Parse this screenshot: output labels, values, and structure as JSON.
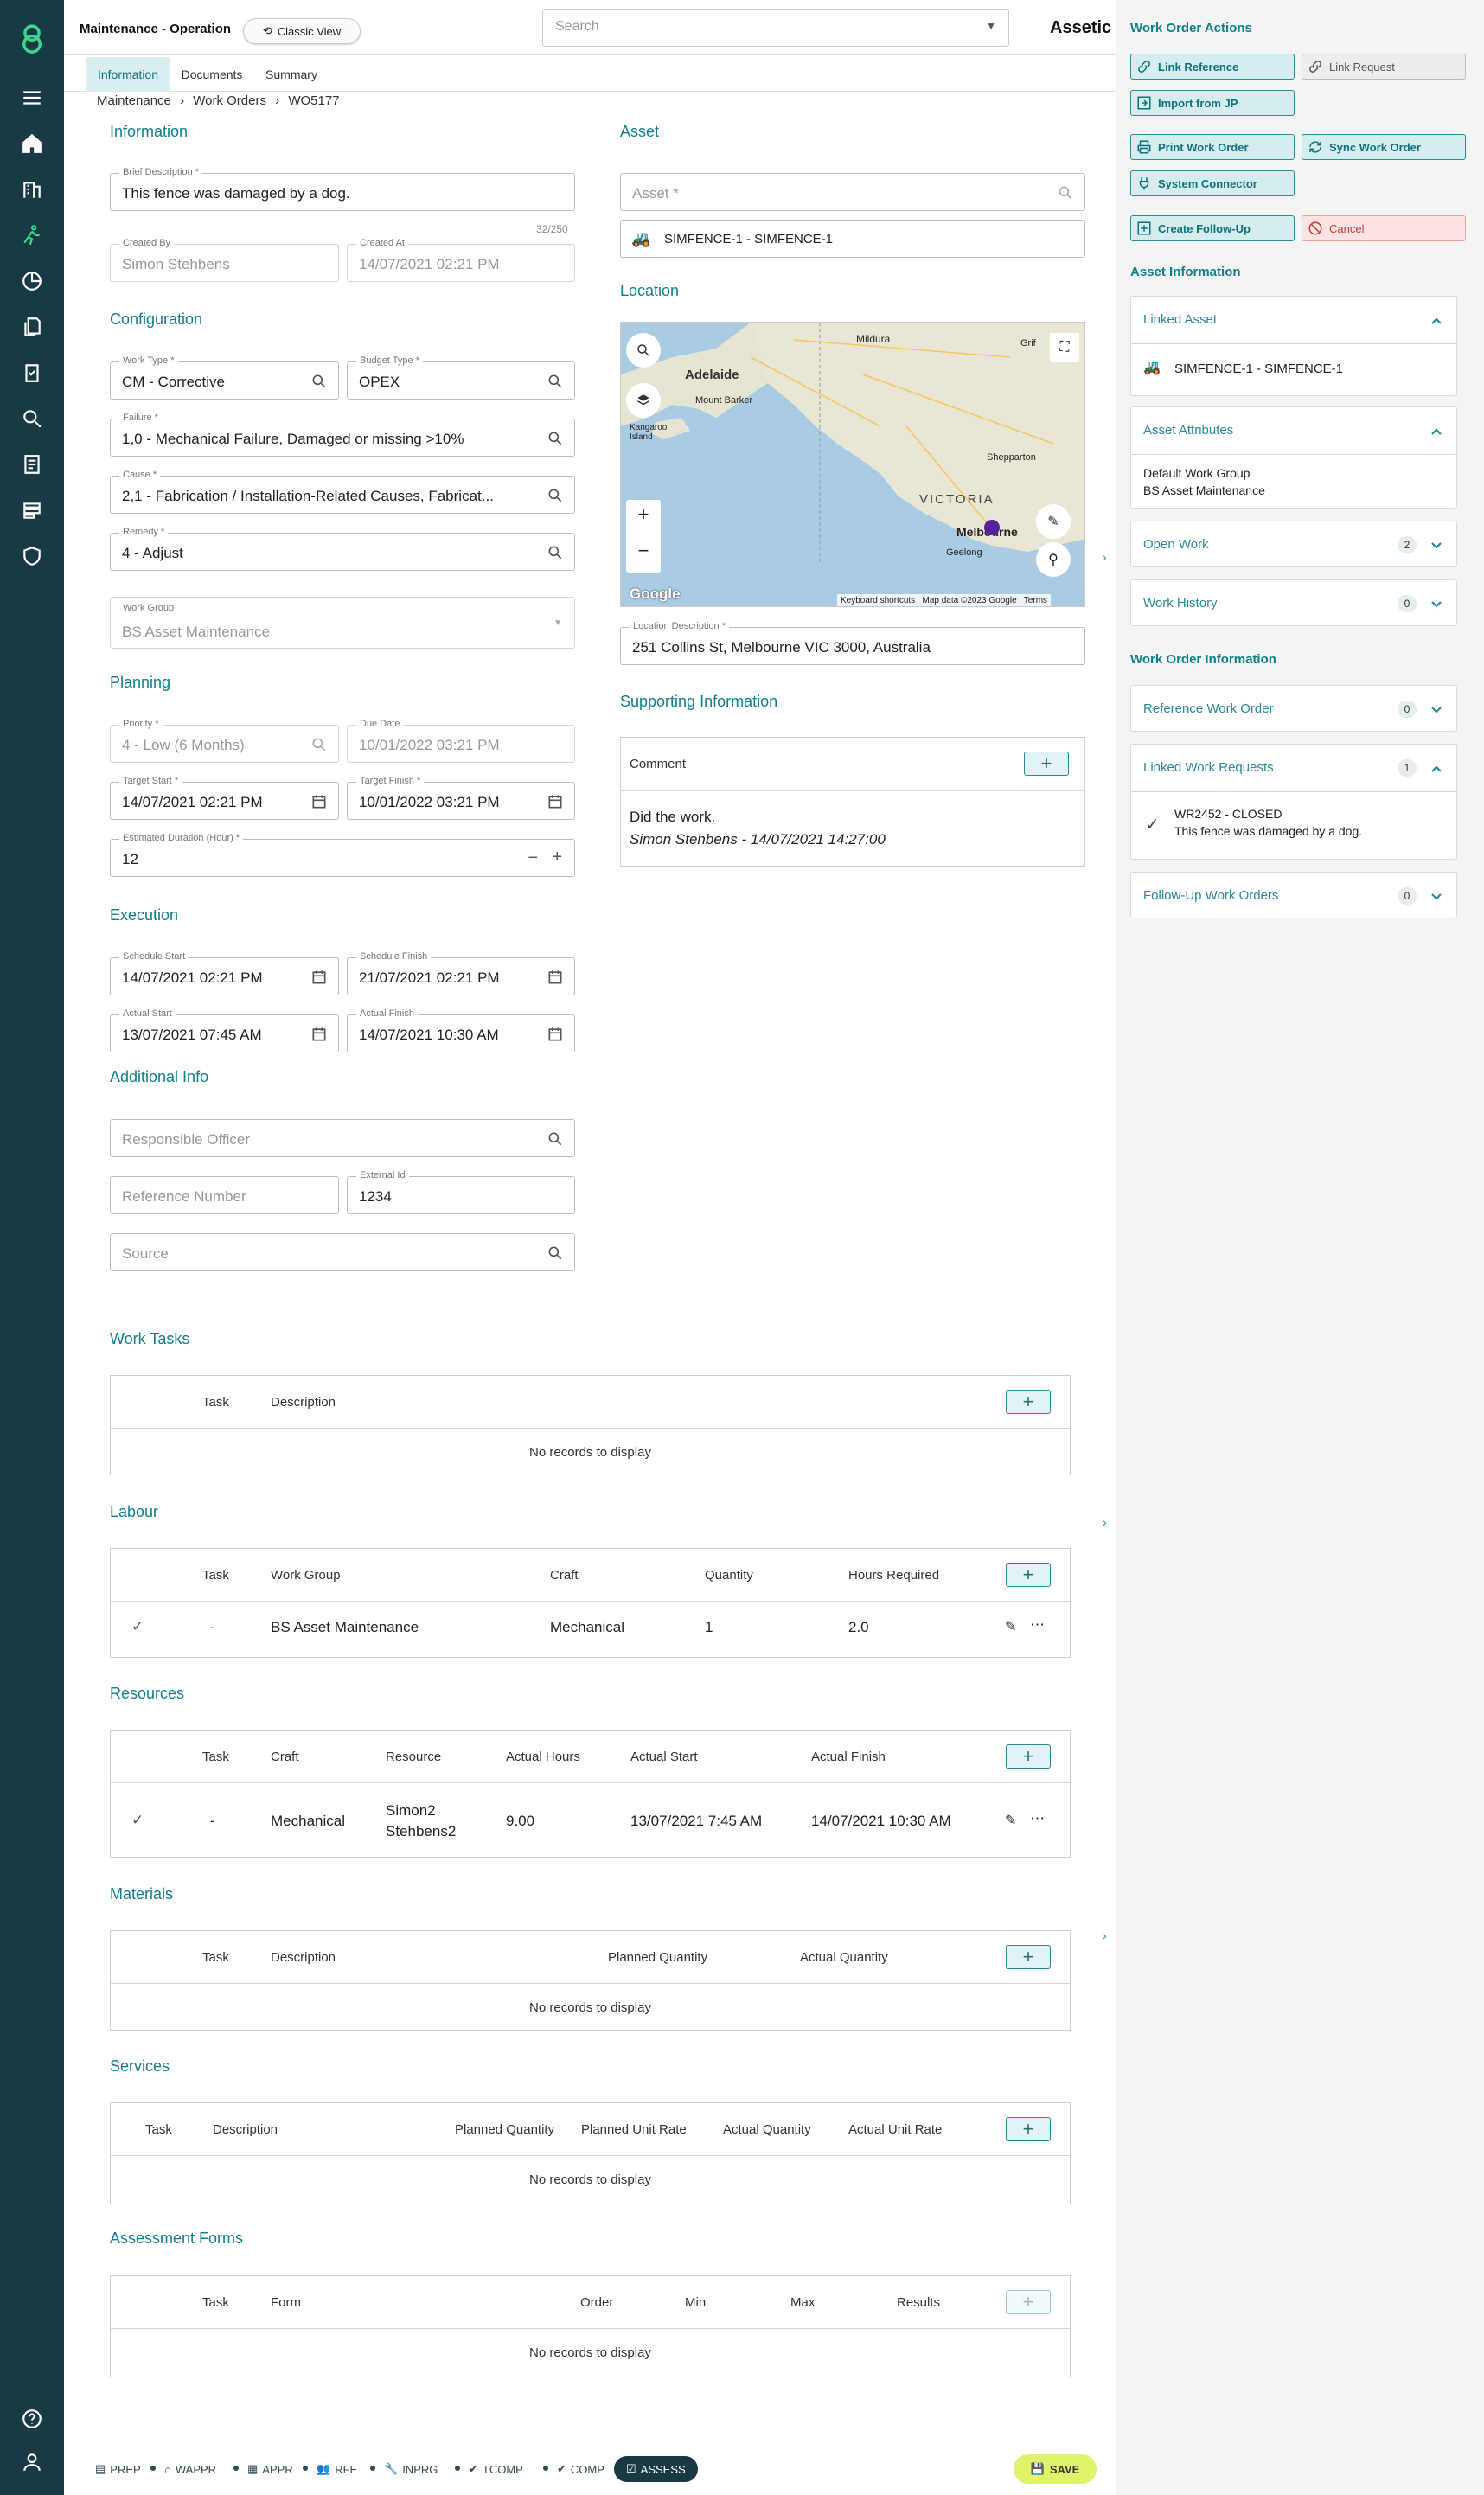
{
  "header": {
    "title": "Maintenance - Operation",
    "classic_view": "Classic View",
    "search_placeholder": "Search",
    "brand": "Assetic"
  },
  "tabs": [
    "Information",
    "Documents",
    "Summary"
  ],
  "breadcrumb": {
    "items": [
      "Maintenance",
      "Work Orders",
      "WO5177"
    ],
    "sep": "›"
  },
  "information": {
    "title": "Information",
    "brief_label": "Brief Description *",
    "brief": "This fence was damaged by a dog.",
    "counter": "32/250",
    "created_by_label": "Created By",
    "created_by": "Simon Stehbens",
    "created_at_label": "Created At",
    "created_at": "14/07/2021 02:21 PM"
  },
  "configuration": {
    "title": "Configuration",
    "work_type_label": "Work Type *",
    "work_type": "CM - Corrective",
    "budget_type_label": "Budget Type *",
    "budget_type": "OPEX",
    "failure_label": "Failure *",
    "failure": "1,0 - Mechanical Failure, Damaged or missing  >10%",
    "cause_label": "Cause *",
    "cause": "2,1 - Fabrication / Installation-Related Causes, Fabricat...",
    "remedy_label": "Remedy *",
    "remedy": "4 - Adjust",
    "work_group_label": "Work Group",
    "work_group": "BS Asset Maintenance"
  },
  "planning": {
    "title": "Planning",
    "priority_label": "Priority *",
    "priority": "4 - Low (6 Months)",
    "due_label": "Due Date",
    "due": "10/01/2022 03:21 PM",
    "target_start_label": "Target Start *",
    "target_start": "14/07/2021 02:21 PM",
    "target_finish_label": "Target Finish *",
    "target_finish": "10/01/2022 03:21 PM",
    "duration_label": "Estimated Duration (Hour) *",
    "duration": "12"
  },
  "execution": {
    "title": "Execution",
    "sched_start_label": "Schedule Start",
    "sched_start": "14/07/2021 02:21 PM",
    "sched_finish_label": "Schedule Finish",
    "sched_finish": "21/07/2021 02:21 PM",
    "actual_start_label": "Actual Start",
    "actual_start": "13/07/2021 07:45 AM",
    "actual_finish_label": "Actual Finish",
    "actual_finish": "14/07/2021 10:30 AM"
  },
  "additional": {
    "title": "Additional Info",
    "officer_ph": "Responsible Officer",
    "ref_ph": "Reference Number",
    "ext_label": "External Id",
    "ext": "1234",
    "source_ph": "Source"
  },
  "asset": {
    "title": "Asset",
    "asset_ph": "Asset *",
    "asset_value": "SIMFENCE-1 - SIMFENCE-1"
  },
  "location": {
    "title": "Location",
    "desc_label": "Location Description *",
    "desc": "251 Collins St, Melbourne VIC 3000, Australia",
    "map": {
      "labels": [
        "Mildura",
        "Adelaide",
        "Mount Barker",
        "Kangaroo Island",
        "Shepparton",
        "VICTORIA",
        "Melbourne",
        "Geelong",
        "Grif"
      ],
      "google": "Google",
      "shortcuts": "Keyboard shortcuts",
      "mapdata": "Map data ©2023 Google",
      "terms": "Terms"
    }
  },
  "supporting": {
    "title": "Supporting Information",
    "comment_header": "Comment",
    "comment": "Did the work.",
    "comment_by": "Simon Stehbens - 14/07/2021 14:27:00"
  },
  "work_tasks": {
    "title": "Work Tasks",
    "cols": [
      "Task",
      "Description"
    ],
    "empty": "No records to display"
  },
  "labour": {
    "title": "Labour",
    "cols": [
      "Task",
      "Work Group",
      "Craft",
      "Quantity",
      "Hours Required"
    ],
    "row": {
      "task": "-",
      "work_group": "BS Asset Maintenance",
      "craft": "Mechanical",
      "quantity": "1",
      "hours": "2.0"
    }
  },
  "resources": {
    "title": "Resources",
    "cols": [
      "Task",
      "Craft",
      "Resource",
      "Actual Hours",
      "Actual Start",
      "Actual Finish"
    ],
    "row": {
      "task": "-",
      "craft": "Mechanical",
      "resource1": "Simon2",
      "resource2": "Stehbens2",
      "hours": "9.00",
      "start": "13/07/2021 7:45 AM",
      "finish": "14/07/2021 10:30 AM"
    }
  },
  "materials": {
    "title": "Materials",
    "cols": [
      "Task",
      "Description",
      "Planned Quantity",
      "Actual Quantity"
    ],
    "empty": "No records to display"
  },
  "services": {
    "title": "Services",
    "cols": [
      "Task",
      "Description",
      "Planned Quantity",
      "Planned Unit Rate",
      "Actual Quantity",
      "Actual Unit Rate"
    ],
    "empty": "No records to display"
  },
  "assessment": {
    "title": "Assessment Forms",
    "cols": [
      "Task",
      "Form",
      "Order",
      "Min",
      "Max",
      "Results"
    ],
    "empty": "No records to display"
  },
  "right": {
    "actions_title": "Work Order Actions",
    "actions": {
      "link_reference": "Link Reference",
      "link_request": "Link Request",
      "import_jp": "Import from JP",
      "print": "Print Work Order",
      "sync": "Sync Work Order",
      "connector": "System Connector",
      "followup": "Create Follow-Up",
      "cancel": "Cancel"
    },
    "asset_info_title": "Asset Information",
    "linked_asset": "Linked Asset",
    "linked_asset_value": "SIMFENCE-1 - SIMFENCE-1",
    "asset_attributes": "Asset Attributes",
    "attr1": "Default Work Group",
    "attr2": "BS Asset Maintenance",
    "open_work": "Open Work",
    "open_work_count": "2",
    "work_history": "Work History",
    "work_history_count": "0",
    "wo_info_title": "Work Order Information",
    "ref_wo": "Reference Work Order",
    "ref_wo_count": "0",
    "linked_requests": "Linked Work Requests",
    "linked_requests_count": "1",
    "wr_title": "WR2452 - CLOSED",
    "wr_desc": "This fence was damaged by a dog.",
    "followup_wo": "Follow-Up Work Orders",
    "followup_wo_count": "0"
  },
  "status": {
    "items": [
      "PREP",
      "WAPPR",
      "APPR",
      "RFE",
      "INPRG",
      "TCOMP",
      "COMP"
    ],
    "active": "ASSESS",
    "save": "SAVE"
  },
  "colors": {
    "sidebar": "#173a45",
    "accent": "#0f7f8c",
    "active_green": "#3dd68c",
    "save": "#dff26a"
  }
}
